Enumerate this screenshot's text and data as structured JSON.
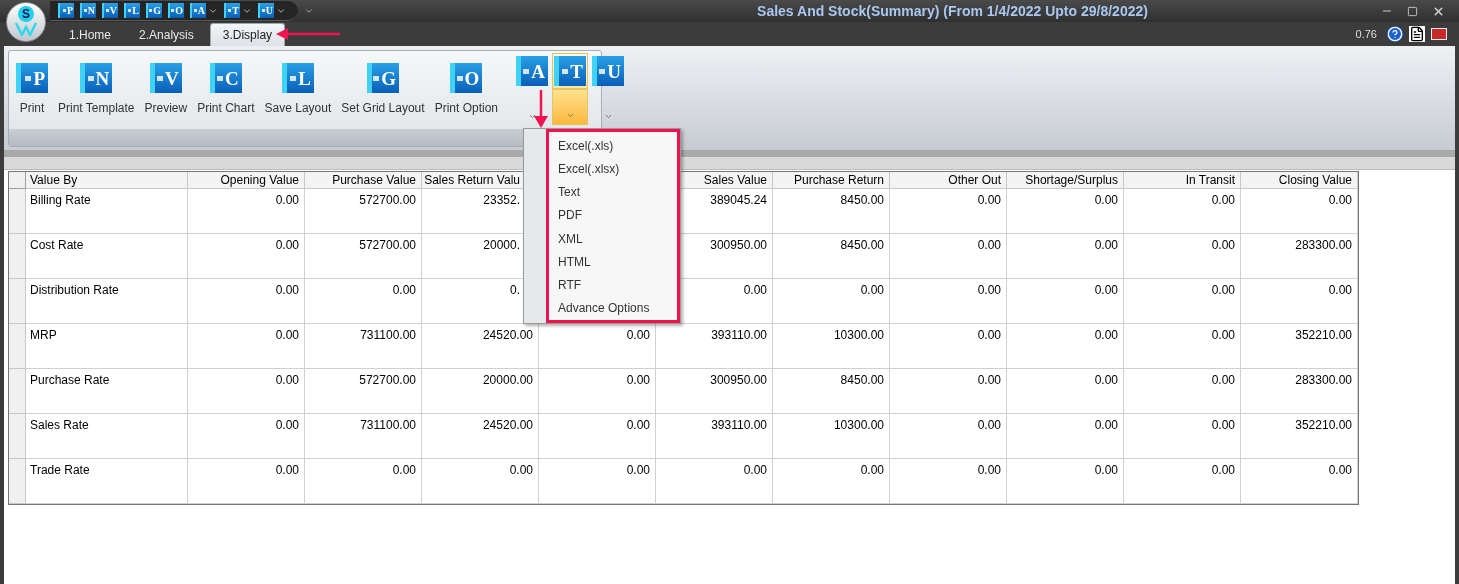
{
  "window": {
    "title": "Sales And Stock(Summary) (From 1/4/2022 Upto 29/8/2022)",
    "logo_letter": "S"
  },
  "quick_access": [
    {
      "glyph": "P",
      "dropdown": false
    },
    {
      "glyph": "N",
      "dropdown": false
    },
    {
      "glyph": "V",
      "dropdown": false
    },
    {
      "glyph": "L",
      "dropdown": false
    },
    {
      "glyph": "G",
      "dropdown": false
    },
    {
      "glyph": "O",
      "dropdown": false
    },
    {
      "glyph": "A",
      "dropdown": true
    },
    {
      "glyph": "T",
      "dropdown": true
    },
    {
      "glyph": "U",
      "dropdown": true
    }
  ],
  "tabs": [
    {
      "label": "1.Home",
      "selected": false
    },
    {
      "label": "2.Analysis",
      "selected": false
    },
    {
      "label": "3.Display",
      "selected": true
    }
  ],
  "status": {
    "version": "0.76"
  },
  "ribbon": [
    {
      "kind": "large",
      "glyph": "P",
      "label": "Print"
    },
    {
      "kind": "large",
      "glyph": "N",
      "label": "Print Template"
    },
    {
      "kind": "large",
      "glyph": "V",
      "label": "Preview"
    },
    {
      "kind": "large",
      "glyph": "C",
      "label": "Print Chart"
    },
    {
      "kind": "large",
      "glyph": "L",
      "label": "Save Layout"
    },
    {
      "kind": "large",
      "glyph": "G",
      "label": "Set Grid Layout"
    },
    {
      "kind": "large",
      "glyph": "O",
      "label": "Print Option"
    },
    {
      "kind": "split",
      "glyph": "A",
      "selected": false
    },
    {
      "kind": "split",
      "glyph": "T",
      "selected": true
    },
    {
      "kind": "split",
      "glyph": "U",
      "selected": false
    }
  ],
  "export_menu": [
    "Excel(.xls)",
    "Excel(.xlsx)",
    "Text",
    "PDF",
    "XML",
    "HTML",
    "RTF",
    "Advance Options"
  ],
  "table": {
    "columns": [
      "Value By",
      "Opening Value",
      "Purchase Value",
      "Sales Return Valu",
      null,
      "Sales Value",
      "Purchase Return",
      "Other Out",
      "Shortage/Surplus",
      "In Transit",
      "Closing Value"
    ],
    "rows": [
      [
        "Billing Rate",
        "0.00",
        "572700.00",
        "23352.",
        null,
        "389045.24",
        "8450.00",
        "0.00",
        "0.00",
        "0.00",
        "0.00"
      ],
      [
        "Cost Rate",
        "0.00",
        "572700.00",
        "20000.",
        null,
        "300950.00",
        "8450.00",
        "0.00",
        "0.00",
        "0.00",
        "283300.00"
      ],
      [
        "Distribution Rate",
        "0.00",
        "0.00",
        "0.",
        null,
        "0.00",
        "0.00",
        "0.00",
        "0.00",
        "0.00",
        "0.00"
      ],
      [
        "MRP",
        "0.00",
        "731100.00",
        "24520.00",
        "0.00",
        "393110.00",
        "10300.00",
        "0.00",
        "0.00",
        "0.00",
        "352210.00"
      ],
      [
        "Purchase Rate",
        "0.00",
        "572700.00",
        "20000.00",
        "0.00",
        "300950.00",
        "8450.00",
        "0.00",
        "0.00",
        "0.00",
        "283300.00"
      ],
      [
        "Sales Rate",
        "0.00",
        "731100.00",
        "24520.00",
        "0.00",
        "393110.00",
        "10300.00",
        "0.00",
        "0.00",
        "0.00",
        "352210.00"
      ],
      [
        "Trade Rate",
        "0.00",
        "0.00",
        "0.00",
        "0.00",
        "0.00",
        "0.00",
        "0.00",
        "0.00",
        "0.00",
        "0.00"
      ]
    ]
  }
}
